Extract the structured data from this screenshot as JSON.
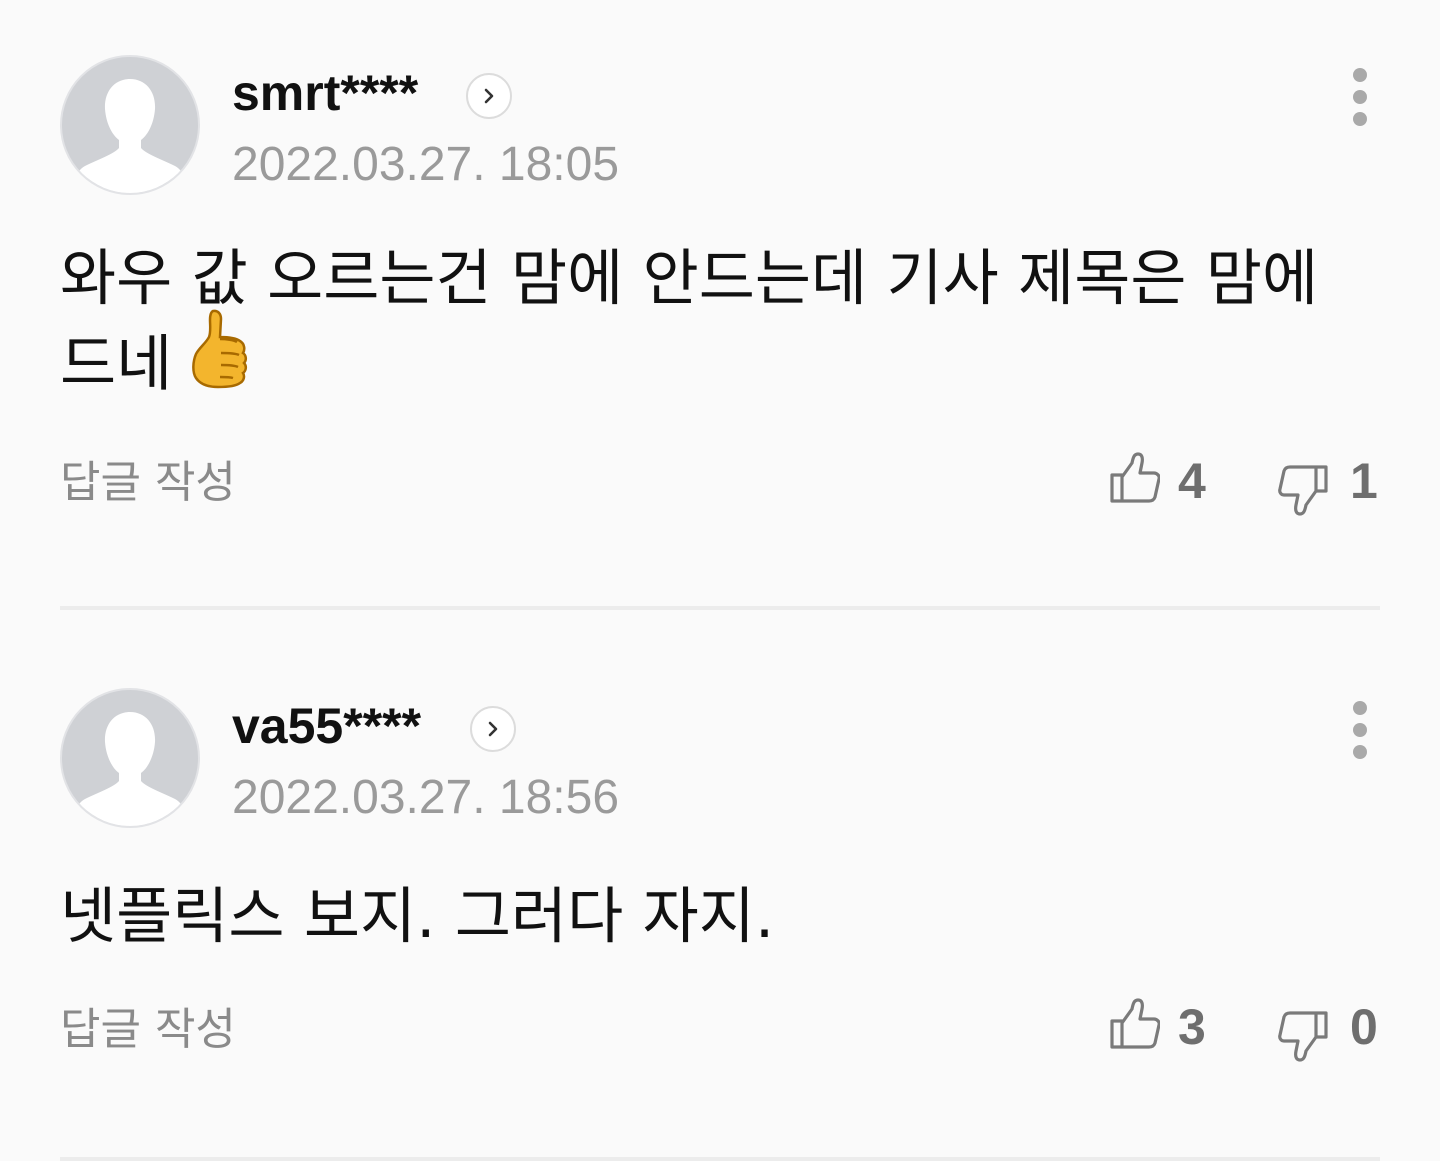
{
  "comments": [
    {
      "username": "smrt****",
      "timestamp": "2022.03.27. 18:05",
      "body": "와우 값 오르는건 맘에 안드는데 기사 제목은 맘에 드네",
      "emoji": "thumbs-up-emoji",
      "reply_label": "답글 작성",
      "likes": "4",
      "dislikes": "1"
    },
    {
      "username": "va55****",
      "timestamp": "2022.03.27. 18:56",
      "body": "넷플릭스 보지. 그러다 자지.",
      "reply_label": "답글 작성",
      "likes": "3",
      "dislikes": "0"
    }
  ],
  "colors": {
    "background": "#fafafa",
    "username": "#111111",
    "timestamp": "#9a9a9a",
    "reply": "#8a8a8a",
    "count": "#6e6e6e",
    "avatar": "#cfd1d5",
    "divider": "#ececec"
  },
  "icons": [
    "default-avatar-icon",
    "chevron-right-icon",
    "more-vertical-icon",
    "thumbs-up-outline-icon",
    "thumbs-down-outline-icon"
  ]
}
